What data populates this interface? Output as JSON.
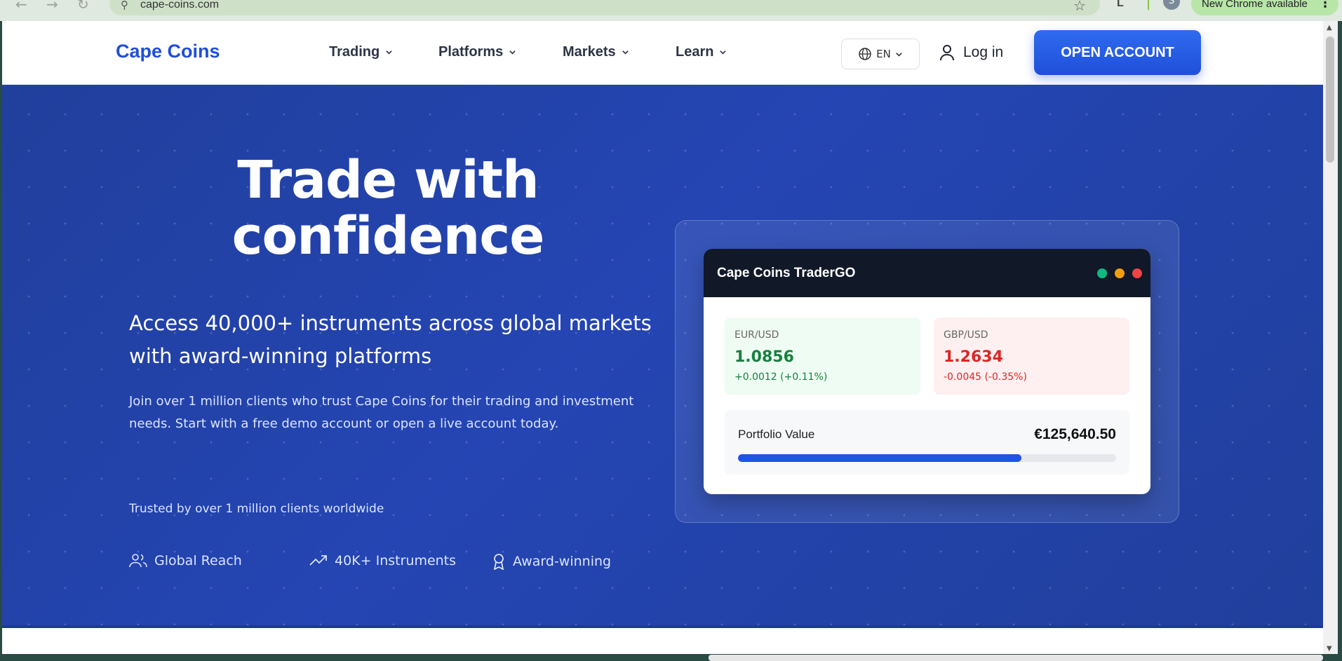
{
  "browser": {
    "url": "cape-coins.com",
    "profile_initial": "S",
    "update_label": "New Chrome available",
    "lens_label": "L",
    "back_icon": "back-arrow-icon",
    "forward_icon": "forward-arrow-icon",
    "reload_icon": "reload-icon"
  },
  "header": {
    "logo": "Cape Coins",
    "nav": [
      {
        "label": "Trading"
      },
      {
        "label": "Platforms"
      },
      {
        "label": "Markets"
      },
      {
        "label": "Learn"
      }
    ],
    "language": "EN",
    "login": "Log in",
    "cta": "OPEN ACCOUNT"
  },
  "hero": {
    "title_line1": "Trade with",
    "title_line2": "confidence",
    "subtitle": "Access 40,000+ instruments across global markets with award-winning platforms",
    "description": "Join over 1 million clients who trust Cape Coins for their trading and investment needs. Start with a free demo account or open a live account today.",
    "trusted": "Trusted by over 1 million clients worldwide",
    "features": [
      {
        "label": "Global Reach",
        "icon": "users-icon"
      },
      {
        "label": "40K+ Instruments",
        "icon": "trending-up-icon"
      },
      {
        "label": "Award-winning",
        "icon": "award-icon"
      }
    ]
  },
  "widget": {
    "title": "Cape Coins TraderGO",
    "window_dots": [
      "#10b981",
      "#f59e0b",
      "#ef4444"
    ],
    "quotes": [
      {
        "pair": "EUR/USD",
        "price": "1.0856",
        "change": "+0.0012 (+0.11%)",
        "color": "#15803d",
        "bg": "#effcf3"
      },
      {
        "pair": "GBP/USD",
        "price": "1.2634",
        "change": "-0.0045 (-0.35%)",
        "color": "#dc2626",
        "bg": "#fef0f0"
      }
    ],
    "portfolio": {
      "label": "Portfolio Value",
      "value": "€125,640.50",
      "progress": 0.75
    }
  },
  "colors": {
    "brand": "#1f4fd8",
    "hero_bg": "#2445b3"
  }
}
